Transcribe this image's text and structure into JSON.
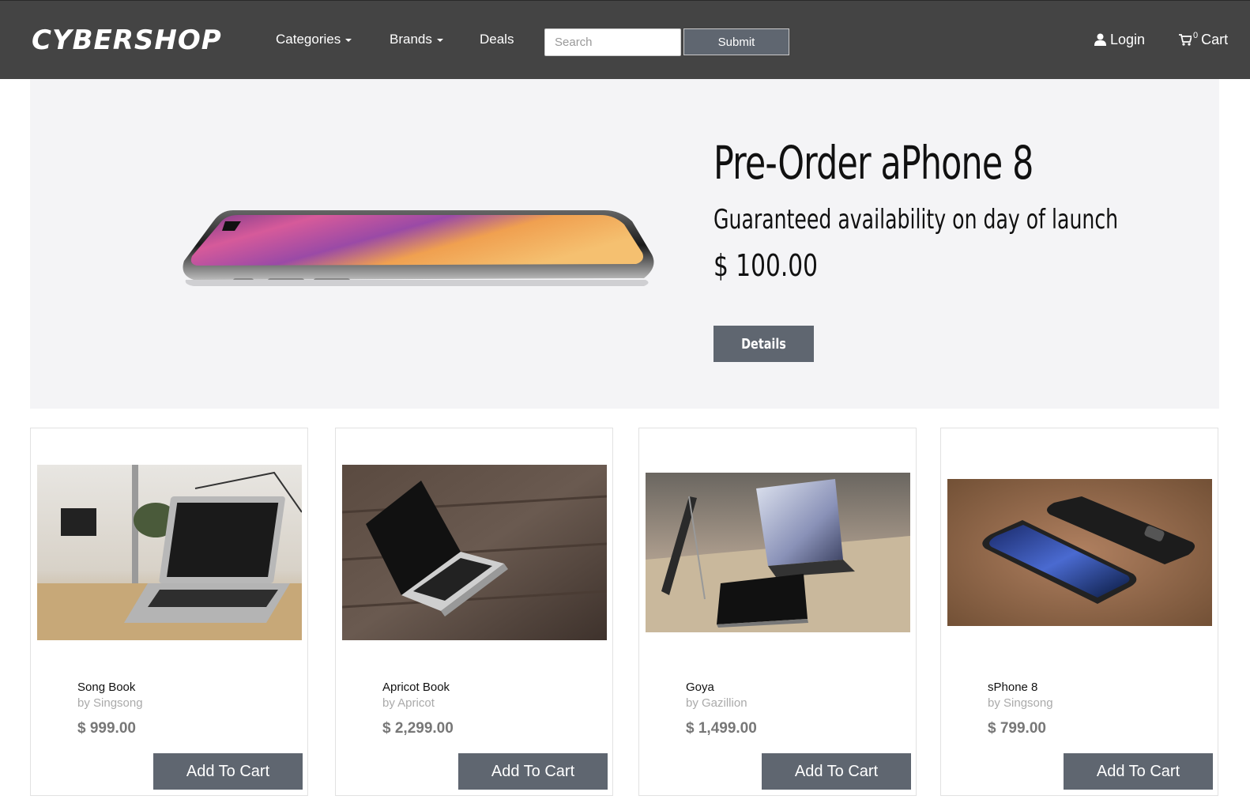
{
  "navbar": {
    "brand": "CYBERSHOP",
    "categories": "Categories",
    "brands": "Brands",
    "deals": "Deals",
    "search_placeholder": "Search",
    "submit": "Submit",
    "login": "Login",
    "cart_count": "0",
    "cart": "Cart"
  },
  "hero": {
    "title": "Pre-Order aPhone 8",
    "subtitle": "Guaranteed availability on day of launch",
    "price": "$ 100.00",
    "button": "Details"
  },
  "products": [
    {
      "name": "Song Book",
      "brand": "by Singsong",
      "price": "$ 999.00",
      "button": "Add To Cart"
    },
    {
      "name": "Apricot Book",
      "brand": "by Apricot",
      "price": "$ 2,299.00",
      "button": "Add To Cart"
    },
    {
      "name": "Goya",
      "brand": "by Gazillion",
      "price": "$ 1,499.00",
      "button": "Add To Cart"
    },
    {
      "name": "sPhone 8",
      "brand": "by Singsong",
      "price": "$ 799.00",
      "button": "Add To Cart"
    }
  ],
  "colors": {
    "navbar": "#444444",
    "hero_bg": "#f4f4f6",
    "button": "#5f6670",
    "price": "#777777"
  }
}
